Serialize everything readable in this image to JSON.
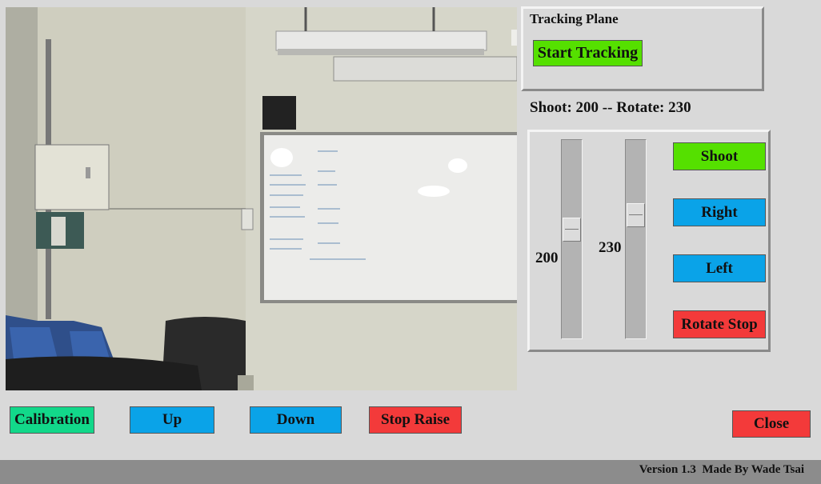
{
  "camera_view": {
    "icon": "camera-feed"
  },
  "tracking": {
    "title": "Tracking Plane",
    "start_label": "Start Tracking"
  },
  "status": {
    "text": "Shoot: 200 -- Rotate: 230"
  },
  "sliders": {
    "shoot": {
      "value": "200",
      "level": 200
    },
    "rotate": {
      "value": "230",
      "level": 230
    }
  },
  "controls": {
    "shoot_label": "Shoot",
    "right_label": "Right",
    "left_label": "Left",
    "rotate_stop_label": "Rotate Stop"
  },
  "bottom_buttons": {
    "calibration_label": "Calibration",
    "up_label": "Up",
    "down_label": "Down",
    "stop_raise_label": "Stop Raise",
    "close_label": "Close"
  },
  "footer": {
    "text": "Version 1.3  Made By Wade Tsai"
  },
  "colors": {
    "green": "#55e000",
    "blue": "#0aa3e8",
    "red": "#f33a3a",
    "teal": "#12d88a"
  }
}
